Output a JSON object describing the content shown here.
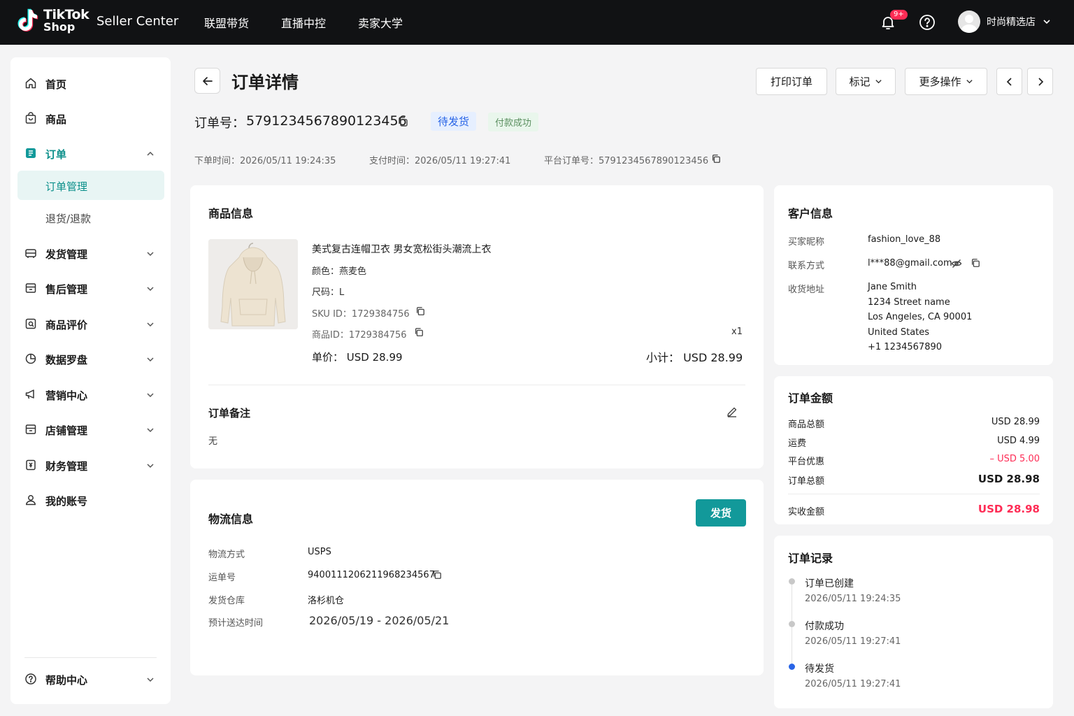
{
  "header": {
    "logo_line1": "TikTok",
    "logo_line2": "Shop",
    "seller_center": "Seller Center",
    "nav": [
      "联盟带货",
      "直播中控",
      "卖家大学"
    ],
    "notification_badge": "9+",
    "user_name": "时尚精选店"
  },
  "sidebar": {
    "items": [
      {
        "label": "首页",
        "icon": "home-icon"
      },
      {
        "label": "商品",
        "icon": "bag-icon"
      },
      {
        "label": "订单",
        "icon": "order-icon"
      },
      {
        "label": "订单管理"
      },
      {
        "label": "退货/退款"
      },
      {
        "label": "发货管理",
        "icon": "truck-icon"
      },
      {
        "label": "售后管理",
        "icon": "store-icon"
      },
      {
        "label": "商品评价",
        "icon": "review-icon"
      },
      {
        "label": "数据罗盘",
        "icon": "compass-icon"
      },
      {
        "label": "营销中心",
        "icon": "megaphone-icon"
      },
      {
        "label": "店铺管理",
        "icon": "shop-icon"
      },
      {
        "label": "财务管理",
        "icon": "finance-icon"
      },
      {
        "label": "我的账号",
        "icon": "user-icon"
      }
    ],
    "help": "帮助中心"
  },
  "page": {
    "title": "订单详情",
    "actions": {
      "print": "打印订单",
      "mark": "标记",
      "more": "更多操作"
    },
    "order_no_label": "订单号：",
    "order_no": "5791234567890123456",
    "status_tag": "待发货",
    "payment_tag": "付款成功",
    "meta": {
      "created": "下单时间：2026/05/11  19:24:35",
      "paid": "支付时间：2026/05/11  19:27:41",
      "platform_no": "平台订单号：5791234567890123456"
    }
  },
  "product_card": {
    "title": "商品信息",
    "name": "美式复古连帽卫衣 男女宽松街头潮流上衣",
    "color": "颜色：燕麦色",
    "size": "尺码：L",
    "sku": "SKU ID：1729384756",
    "product_id": "商品ID：1729384756",
    "qty": "x1",
    "unit_price": "单价：  USD 28.99",
    "subtotal": "小计：  USD 28.99",
    "note_title": "订单备注",
    "note_value": "无"
  },
  "logistics": {
    "title": "物流信息",
    "ship_button": "发货",
    "rows": [
      {
        "label": "物流方式",
        "value": "USPS"
      },
      {
        "label": "运单号",
        "value": "9400111206211968234567"
      },
      {
        "label": "发货仓库",
        "value": "洛杉机仓"
      },
      {
        "label": "预计送达时间",
        "value": "2026/05/19 - 2026/05/21"
      }
    ]
  },
  "customer": {
    "title": "客户信息",
    "nickname_label": "买家昵称",
    "nickname": "fashion_love_88",
    "contact_label": "联系方式",
    "contact": "l***88@gmail.com",
    "address_label": "收货地址",
    "address_lines": [
      "Jane Smith",
      "1234 Street name",
      "Los Angeles, CA 90001",
      "United States",
      "+1 1234567890"
    ]
  },
  "amount": {
    "title": "订单金额",
    "rows": [
      {
        "label": "商品总额",
        "value": "USD 28.99"
      },
      {
        "label": "运费",
        "value": "USD 4.99"
      },
      {
        "label": "平台优惠",
        "value": "– USD 5.00"
      },
      {
        "label": "订单总额",
        "value": "USD 28.98"
      }
    ],
    "received_label": "实收金额",
    "received_value": "USD 28.98",
    "colors": {
      "discount": "#fe2c55",
      "received": "#fe2c55"
    }
  },
  "records": {
    "title": "订单记录",
    "items": [
      {
        "title": "订单已创建",
        "time": "2026/05/11  19:24:35"
      },
      {
        "title": "付款成功",
        "time": "2026/05/11  19:27:41"
      },
      {
        "title": "待发货",
        "time": "2026/05/11  19:27:41"
      }
    ]
  },
  "colors": {
    "accent": "#12999a",
    "topbar": "#111214",
    "status_blue": "#2864e6"
  }
}
